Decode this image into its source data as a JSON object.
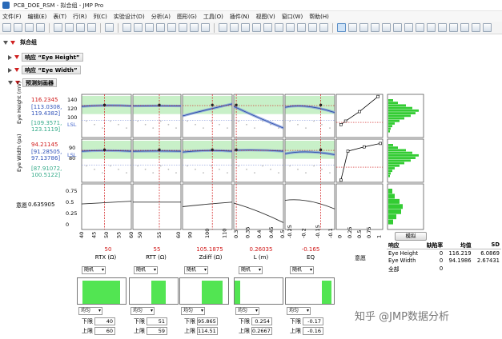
{
  "window": {
    "title": "PCB_DOE_RSM - 拟合组 - JMP Pro"
  },
  "menu": [
    "文件(F)",
    "编辑(E)",
    "表(T)",
    "行(R)",
    "列(C)",
    "实验设计(D)",
    "分析(A)",
    "图形(G)",
    "工具(O)",
    "插件(N)",
    "视图(V)",
    "窗口(W)",
    "帮助(H)"
  ],
  "outline": {
    "fit_group": "拟合组",
    "resp_eye_height": "响应 “Eye Height”",
    "resp_eye_width": "响应 “Eye Width”",
    "profiler": "预测刻画器"
  },
  "responses": [
    {
      "name": "Eye Height (mV)",
      "value": "116.2345",
      "ci": "[113.0308,",
      "ci2": "119.4382]",
      "pi": "[109.3571,",
      "pi2": "123.1119]",
      "ticks": [
        "140",
        "120",
        "100",
        "80"
      ],
      "lsl": "LSL"
    },
    {
      "name": "Eye Width (ps)",
      "value": "94.21145",
      "ci": "[91.28505,",
      "ci2": "97.13786]",
      "pi": "[87.91072,",
      "pi2": "100.5122]",
      "ticks": [
        "90",
        "80",
        "70"
      ],
      "lsl": "LSL"
    },
    {
      "name": "意愿",
      "value": "0.635905",
      "ticks": [
        "0.75",
        "0.5",
        "0.25",
        "0"
      ]
    }
  ],
  "factors": [
    {
      "name": "RTX (Ω)",
      "value": "50",
      "ticks": [
        "40",
        "45",
        "50",
        "55",
        "60"
      ],
      "random_label": "随机",
      "dist_label": "均匀",
      "lower_label": "下限",
      "upper_label": "上限",
      "lower": "40",
      "upper": "60"
    },
    {
      "name": "RTT (Ω)",
      "value": "55",
      "ticks": [
        "50",
        "55",
        "60"
      ],
      "random_label": "随机",
      "dist_label": "均匀",
      "lower_label": "下限",
      "upper_label": "上限",
      "lower": "51",
      "upper": "59"
    },
    {
      "name": "Zdiff (Ω)",
      "value": "105.1875",
      "ticks": [
        "90",
        "100",
        "110"
      ],
      "random_label": "随机",
      "dist_label": "均匀",
      "lower_label": "下限",
      "upper_label": "上限",
      "lower": "95.865",
      "upper": "114.51"
    },
    {
      "name": "L (m)",
      "value": "0.26035",
      "ticks": [
        "0.3",
        "0.35",
        "0.4",
        "0.45",
        "0.5"
      ],
      "random_label": "随机",
      "dist_label": "均匀",
      "lower_label": "下限",
      "upper_label": "上限",
      "lower": "0.254",
      "upper": "0.2667"
    },
    {
      "name": "EQ",
      "value": "-0.165",
      "ticks": [
        "-0.25",
        "-0.2",
        "-0.15",
        "-0.1"
      ],
      "random_label": "随机",
      "dist_label": "均匀",
      "lower_label": "下限",
      "upper_label": "上限",
      "lower": "-0.17",
      "upper": "-0.16"
    }
  ],
  "desirability_col": {
    "label": "意愿",
    "ticks": [
      "0",
      "0.25",
      "0.5",
      "0.75",
      "1"
    ]
  },
  "simulate_button": "模拟",
  "stats": {
    "headers": [
      "响应",
      "缺陷率",
      "均值",
      "SD"
    ],
    "rows": [
      [
        "Eye Height",
        "0",
        "116.219",
        "6.0869"
      ],
      [
        "Eye Width",
        "0",
        "94.1986",
        "2.67431"
      ],
      [
        "全部",
        "0",
        "",
        ""
      ]
    ]
  },
  "watermark": "知乎 @JMP数据分析",
  "colors": {
    "green_band": "#c8f0c8",
    "curve_blue": "#2a4aa8",
    "red_line": "#d01818",
    "hist_green": "#33cc33"
  }
}
